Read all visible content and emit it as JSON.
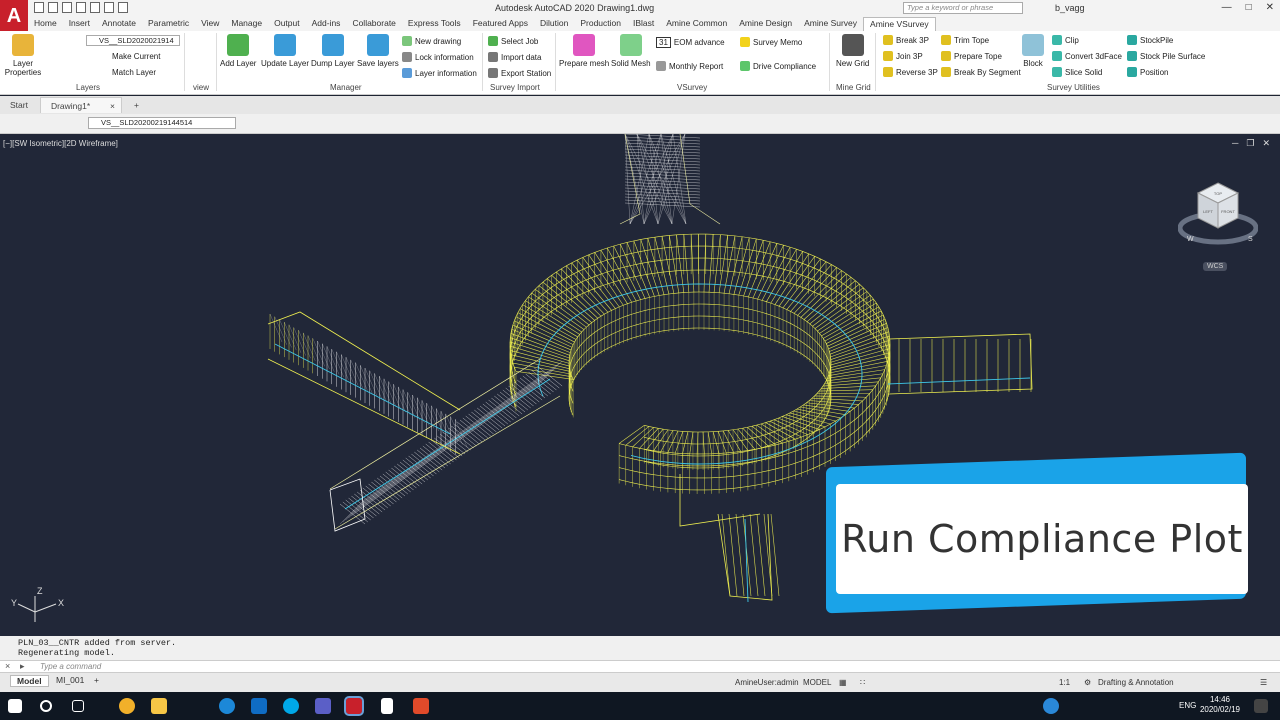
{
  "app": {
    "logo_letter": "A",
    "title": "Autodesk AutoCAD 2020     Drawing1.dwg",
    "search_placeholder": "Type a keyword or phrase",
    "user": "b_vagg"
  },
  "tabs": [
    "Home",
    "Insert",
    "Annotate",
    "Parametric",
    "View",
    "Manage",
    "Output",
    "Add-ins",
    "Collaborate",
    "Express Tools",
    "Featured Apps",
    "Dilution",
    "Production",
    "IBlast",
    "Amine Common",
    "Amine Design",
    "Amine Survey",
    "Amine VSurvey"
  ],
  "active_tab": "Amine VSurvey",
  "ribbon": {
    "layers": {
      "title": "Layers",
      "layer_properties": "Layer Properties",
      "layer_combo": "VS__SLD2020021914",
      "make_current": "Make Current",
      "match_layer": "Match Layer",
      "view_title": "view"
    },
    "manager": {
      "title": "Manager",
      "add_layer": "Add Layer",
      "update_layer": "Update Layer",
      "dump_layer": "Dump Layer",
      "save_layers": "Save layers",
      "new_drawing": "New drawing",
      "lock_information": "Lock information",
      "layer_information": "Layer information"
    },
    "survey_import": {
      "title": "Survey Import",
      "select_job": "Select Job",
      "import_data": "Import data",
      "export_station": "Export Station"
    },
    "vsurvey": {
      "title": "VSurvey",
      "prepare_mesh": "Prepare mesh",
      "solid_mesh": "Solid Mesh",
      "calendar_day": "31",
      "eom_advance": "EOM advance",
      "monthly_report": "Monthly Report",
      "survey_memo": "Survey Memo",
      "drive_compliance": "Drive Compliance"
    },
    "mine_grid": {
      "title": "Mine Grid",
      "new_grid": "New Grid"
    },
    "survey_utilities": {
      "title": "Survey Utilities",
      "break_3p": "Break 3P",
      "join_3p": "Join 3P",
      "reverse_3p": "Reverse 3P",
      "trim_tope": "Trim Tope",
      "prepare_tope": "Prepare Tope",
      "break_by_segment": "Break By Segment",
      "block": "Block",
      "clip": "Clip",
      "convert_3dface": "Convert 3dFace",
      "slice_solid": "Slice Solid",
      "stockpile": "StockPile",
      "stock_pile_surface": "Stock Pile Surface",
      "position": "Position"
    }
  },
  "file_tabs": {
    "start": "Start",
    "drawing": "Drawing1*"
  },
  "layer_toolbar": {
    "current_layer": "VS__SLD20200219144514"
  },
  "viewport": {
    "label": "[−][SW Isometric][2D Wireframe]",
    "viewcube_faces": [
      "TOP",
      "LEFT",
      "FRONT"
    ],
    "compass": [
      "W",
      "S"
    ],
    "wcs": "WCS",
    "ucs_axes": [
      "Y",
      "Z",
      "X"
    ]
  },
  "callout": {
    "text": "Run Compliance Plot"
  },
  "command": {
    "history": [
      "PLN_03__CNTR added from server.",
      "Regenerating model."
    ],
    "placeholder": "Type a command"
  },
  "layout_tabs": [
    "Model",
    "MI_001"
  ],
  "status": {
    "user": "AmineUser:admin",
    "space": "MODEL",
    "scale": "1:1",
    "workspace": "Drafting & Annotation"
  },
  "taskbar": {
    "lang": "ENG",
    "time": "14:46",
    "date": "2020/02/19"
  },
  "colors": {
    "accent": "#1aa3e8",
    "autocad_red": "#c8202b",
    "viewport_bg": "#212738",
    "mesh_yellow": "#f0f050",
    "mesh_cyan": "#3ec8e8"
  }
}
